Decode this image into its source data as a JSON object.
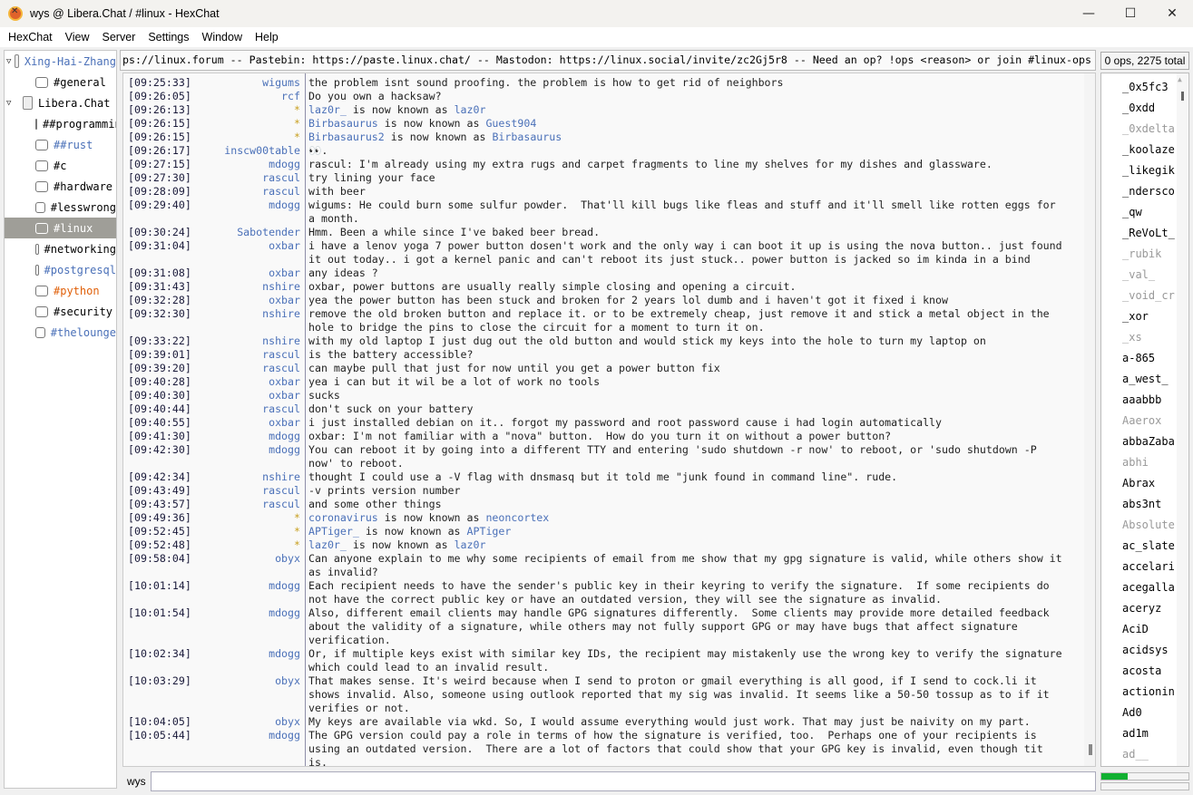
{
  "window": {
    "title": "wys @ Libera.Chat / #linux - HexChat",
    "minimize": "—",
    "maximize": "☐",
    "close": "✕"
  },
  "menu": [
    "HexChat",
    "View",
    "Server",
    "Settings",
    "Window",
    "Help"
  ],
  "tree": [
    {
      "type": "server",
      "label": "Xing-Hai-Zhang",
      "color": "#4a70b8"
    },
    {
      "type": "channel",
      "label": "#general",
      "color": "#000"
    },
    {
      "type": "server",
      "label": "Libera.Chat",
      "color": "#000"
    },
    {
      "type": "channel",
      "label": "##programming",
      "color": "#000"
    },
    {
      "type": "channel",
      "label": "##rust",
      "color": "#4a70b8"
    },
    {
      "type": "channel",
      "label": "#c",
      "color": "#000"
    },
    {
      "type": "channel",
      "label": "#hardware",
      "color": "#000"
    },
    {
      "type": "channel",
      "label": "#lesswrong",
      "color": "#000"
    },
    {
      "type": "channel",
      "label": "#linux",
      "color": "#fff",
      "selected": true
    },
    {
      "type": "channel",
      "label": "#networking",
      "color": "#000"
    },
    {
      "type": "channel",
      "label": "#postgresql",
      "color": "#4a70b8"
    },
    {
      "type": "channel",
      "label": "#python",
      "color": "#e0600a"
    },
    {
      "type": "channel",
      "label": "#security",
      "color": "#000"
    },
    {
      "type": "channel",
      "label": "#thelounge",
      "color": "#4a70b8"
    }
  ],
  "topic": "ps://linux.forum -- Pastebin: https://paste.linux.chat/ -- Mastodon: https://linux.social/invite/zc2Gj5r8 -- Need an op? !ops <reason> or join #linux-ops",
  "ops_summary": "0 ops, 2275 total",
  "messages": [
    {
      "t": "[09:25:33]",
      "n": "wigums",
      "m": "the problem isnt sound proofing. the problem is how to get rid of neighbors"
    },
    {
      "t": "[09:26:05]",
      "n": "rcf",
      "m": "Do you own a hacksaw?"
    },
    {
      "t": "[09:26:13]",
      "n": "*",
      "old": "laz0r_",
      "m": "is now known as",
      "new": "laz0r"
    },
    {
      "t": "[09:26:15]",
      "n": "*",
      "old": "Birbasaurus",
      "m": "is now known as",
      "new": "Guest904"
    },
    {
      "t": "[09:26:15]",
      "n": "*",
      "old": "Birbasaurus2",
      "m": "is now known as",
      "new": "Birbasaurus"
    },
    {
      "t": "[09:26:17]",
      "n": "inscw00table",
      "m": "👀."
    },
    {
      "t": "[09:27:15]",
      "n": "mdogg",
      "m": "rascul: I'm already using my extra rugs and carpet fragments to line my shelves for my dishes and glassware."
    },
    {
      "t": "[09:27:30]",
      "n": "rascul",
      "m": "try lining your face"
    },
    {
      "t": "[09:28:09]",
      "n": "rascul",
      "m": "with beer"
    },
    {
      "t": "[09:29:40]",
      "n": "mdogg",
      "m": "wigums: He could burn some sulfur powder.  That'll kill bugs like fleas and stuff and it'll smell like rotten eggs for a month."
    },
    {
      "t": "[09:30:24]",
      "n": "Sabotender",
      "m": "Hmm. Been a while since I've baked beer bread."
    },
    {
      "t": "[09:31:04]",
      "n": "oxbar",
      "m": "i have a lenov yoga 7 power button dosen't work and the only way i can boot it up is using the nova button.. just found it out today.. i got a kernel panic and can't reboot its just stuck.. power button is jacked so im kinda in a bind"
    },
    {
      "t": "[09:31:08]",
      "n": "oxbar",
      "m": "any ideas ?"
    },
    {
      "t": "[09:31:43]",
      "n": "nshire",
      "m": "oxbar, power buttons are usually really simple closing and opening a circuit."
    },
    {
      "t": "[09:32:28]",
      "n": "oxbar",
      "m": "yea the power button has been stuck and broken for 2 years lol dumb and i haven't got it fixed i know"
    },
    {
      "t": "[09:32:30]",
      "n": "nshire",
      "m": "remove the old broken button and replace it. or to be extremely cheap, just remove it and stick a metal object in the hole to bridge the pins to close the circuit for a moment to turn it on."
    },
    {
      "t": "[09:33:22]",
      "n": "nshire",
      "m": "with my old laptop I just dug out the old button and would stick my keys into the hole to turn my laptop on"
    },
    {
      "t": "[09:39:01]",
      "n": "rascul",
      "m": "is the battery accessible?"
    },
    {
      "t": "[09:39:20]",
      "n": "rascul",
      "m": "can maybe pull that just for now until you get a power button fix"
    },
    {
      "t": "[09:40:28]",
      "n": "oxbar",
      "m": "yea i can but it wil be a lot of work no tools"
    },
    {
      "t": "[09:40:30]",
      "n": "oxbar",
      "m": "sucks"
    },
    {
      "t": "[09:40:44]",
      "n": "rascul",
      "m": "don't suck on your battery"
    },
    {
      "t": "[09:40:55]",
      "n": "oxbar",
      "m": "i just installed debian on it.. forgot my password and root password cause i had login automatically"
    },
    {
      "t": "[09:41:30]",
      "n": "mdogg",
      "m": "oxbar: I'm not familiar with a \"nova\" button.  How do you turn it on without a power button?"
    },
    {
      "t": "[09:42:30]",
      "n": "mdogg",
      "m": "You can reboot it by going into a different TTY and entering 'sudo shutdown -r now' to reboot, or 'sudo shutdown -P now' to reboot."
    },
    {
      "t": "[09:42:34]",
      "n": "nshire",
      "m": "thought I could use a -V flag with dnsmasq but it told me \"junk found in command line\". rude."
    },
    {
      "t": "[09:43:49]",
      "n": "rascul",
      "m": "-v prints version number"
    },
    {
      "t": "[09:43:57]",
      "n": "rascul",
      "m": "and some other things"
    },
    {
      "t": "[09:49:36]",
      "n": "*",
      "old": "coronavirus",
      "m": "is now known as",
      "new": "neoncortex"
    },
    {
      "t": "[09:52:45]",
      "n": "*",
      "old": "APTiger_",
      "m": "is now known as",
      "new": "APTiger"
    },
    {
      "t": "[09:52:48]",
      "n": "*",
      "old": "laz0r_",
      "m": "is now known as",
      "new": "laz0r"
    },
    {
      "t": "[09:58:04]",
      "n": "obyx",
      "m": "Can anyone explain to me why some recipients of email from me show that my gpg signature is valid, while others show it as invalid?"
    },
    {
      "t": "[10:01:14]",
      "n": "mdogg",
      "m": "Each recipient needs to have the sender's public key in their keyring to verify the signature.  If some recipients do not have the correct public key or have an outdated version, they will see the signature as invalid."
    },
    {
      "t": "[10:01:54]",
      "n": "mdogg",
      "m": "Also, different email clients may handle GPG signatures differently.  Some clients may provide more detailed feedback about the validity of a signature, while others may not fully support GPG or may have bugs that affect signature verification."
    },
    {
      "t": "[10:02:34]",
      "n": "mdogg",
      "m": "Or, if multiple keys exist with similar key IDs, the recipient may mistakenly use the wrong key to verify the signature which could lead to an invalid result."
    },
    {
      "t": "[10:03:29]",
      "n": "obyx",
      "m": "That makes sense. It's weird because when I send to proton or gmail everything is all good, if I send to cock.li it shows invalid. Also, someone using outlook reported that my sig was invalid. It seems like a 50-50 tossup as to if it verifies or not."
    },
    {
      "t": "[10:04:05]",
      "n": "obyx",
      "m": "My keys are available via wkd. So, I would assume everything would just work. That may just be naivity on my part."
    },
    {
      "t": "[10:05:44]",
      "n": "mdogg",
      "m": "The GPG version could pay a role in terms of how the signature is verified, too.  Perhaps one of your recipients is using an outdated version.  There are a lot of factors that could show that your GPG key is invalid, even though tit is."
    }
  ],
  "input": {
    "nick": "wys",
    "value": ""
  },
  "users": [
    {
      "n": "_0x5fc3"
    },
    {
      "n": "_0xdd"
    },
    {
      "n": "_0xdelta",
      "away": true
    },
    {
      "n": "_koolaze"
    },
    {
      "n": "_likegik"
    },
    {
      "n": "_ndersco"
    },
    {
      "n": "_qw"
    },
    {
      "n": "_ReVoLt_"
    },
    {
      "n": "_rubik",
      "away": true
    },
    {
      "n": "_val_",
      "away": true
    },
    {
      "n": "_void_cr",
      "away": true
    },
    {
      "n": "_xor"
    },
    {
      "n": "_xs",
      "away": true
    },
    {
      "n": "a-865"
    },
    {
      "n": "a_west_"
    },
    {
      "n": "aaabbb"
    },
    {
      "n": "Aaerox",
      "away": true
    },
    {
      "n": "abbaZaba"
    },
    {
      "n": "abhi",
      "away": true
    },
    {
      "n": "Abrax"
    },
    {
      "n": "abs3nt"
    },
    {
      "n": "Absolute",
      "away": true
    },
    {
      "n": "ac_slate"
    },
    {
      "n": "accelari"
    },
    {
      "n": "acegalla"
    },
    {
      "n": "aceryz"
    },
    {
      "n": "AciD"
    },
    {
      "n": "acidsys"
    },
    {
      "n": "acosta"
    },
    {
      "n": "actionin"
    },
    {
      "n": "Ad0"
    },
    {
      "n": "ad1m"
    },
    {
      "n": "ad__",
      "away": true
    }
  ],
  "lag_fraction": 0.3
}
